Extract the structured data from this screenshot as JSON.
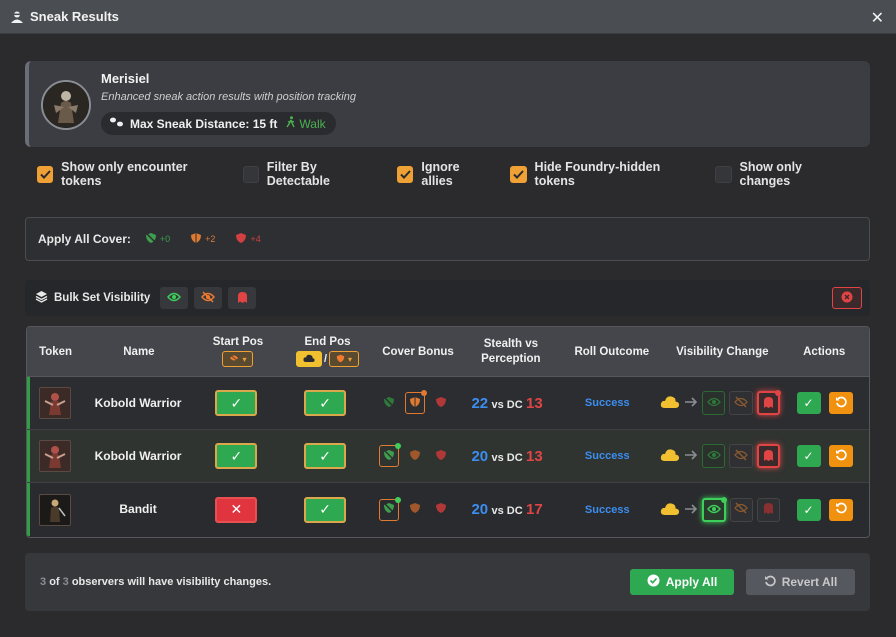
{
  "window": {
    "title": "Sneak Results",
    "close_symbol": "✕"
  },
  "header": {
    "name": "Merisiel",
    "subtitle": "Enhanced sneak action results with position tracking",
    "max_distance_label": "Max Sneak Distance: 15 ft",
    "movement_label": "Walk"
  },
  "filters": [
    {
      "label": "Show only encounter tokens",
      "checked": true
    },
    {
      "label": "Filter By Detectable",
      "checked": false
    },
    {
      "label": "Ignore allies",
      "checked": true
    },
    {
      "label": "Hide Foundry-hidden tokens",
      "checked": true
    },
    {
      "label": "Show only changes",
      "checked": false
    }
  ],
  "cover_bar": {
    "label": "Apply All Cover:",
    "options": [
      {
        "icon": "shield-slash-icon",
        "value": "+0",
        "color": "#3e9e4e"
      },
      {
        "icon": "shield-half-icon",
        "value": "+2",
        "color": "#e07a30"
      },
      {
        "icon": "shield-icon",
        "value": "+4",
        "color": "#d04040"
      }
    ]
  },
  "bulk_bar": {
    "label": "Bulk Set Visibility"
  },
  "table": {
    "headers": {
      "token": "Token",
      "name": "Name",
      "start_pos": "Start Pos",
      "end_pos": "End Pos",
      "end_pos_sep": "/",
      "cover_bonus": "Cover Bonus",
      "stealth_vs_perception": "Stealth vs Perception",
      "roll_outcome": "Roll Outcome",
      "visibility_change": "Visibility Change",
      "actions": "Actions"
    },
    "rows": [
      {
        "name": "Kobold Warrior",
        "start_ok": true,
        "end_ok": true,
        "cover_selected": "+2",
        "stealth": "22",
        "vs_dc": "vs DC",
        "dc": "13",
        "outcome": "Success",
        "vis_selected": "undetected"
      },
      {
        "name": "Kobold Warrior",
        "start_ok": true,
        "end_ok": true,
        "cover_selected": "+0",
        "stealth": "20",
        "vs_dc": "vs DC",
        "dc": "13",
        "outcome": "Success",
        "vis_selected": "undetected"
      },
      {
        "name": "Bandit",
        "start_ok": false,
        "end_ok": true,
        "cover_selected": "+0",
        "stealth": "20",
        "vs_dc": "vs DC",
        "dc": "17",
        "outcome": "Success",
        "vis_selected": "observed"
      }
    ]
  },
  "footer": {
    "count": "3",
    "of": "of",
    "total": "3",
    "summary_text": "observers will have visibility changes.",
    "apply_label": "Apply All",
    "revert_label": "Revert All"
  },
  "colors": {
    "accent_orange": "#f0a135",
    "success_green": "#2ea851",
    "danger_red": "#e0353f",
    "outcome_blue": "#3b8ef0"
  }
}
